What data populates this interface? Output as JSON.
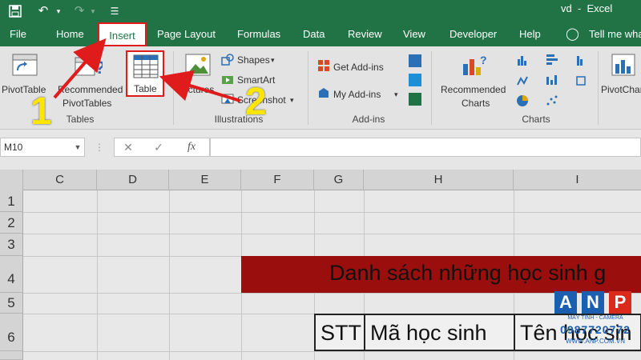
{
  "title_bar": {
    "title": "vd  -  Excel"
  },
  "tabs": [
    "File",
    "Home",
    "Insert",
    "Page Layout",
    "Formulas",
    "Data",
    "Review",
    "View",
    "Developer",
    "Help",
    "Tell me wha"
  ],
  "ribbon": {
    "pivot_table": "PivotTable",
    "recommended_pivot_1": "Recommended",
    "recommended_pivot_2": "PivotTables",
    "table": "Table",
    "pictures": "Pictures",
    "shapes": "Shapes",
    "smartart": "SmartArt",
    "screenshot": "Screenshot",
    "get_addins": "Get Add-ins",
    "my_addins": "My Add-ins",
    "rec_charts_1": "Recommended",
    "rec_charts_2": "Charts",
    "pivot_chart": "PivotChart",
    "groups": {
      "tables": "Tables",
      "illustrations": "Illustrations",
      "addins": "Add-ins",
      "charts": "Charts"
    }
  },
  "formula_bar": {
    "name_box": "M10",
    "cancel": "✕",
    "enter": "✓",
    "fx": "fx",
    "value": ""
  },
  "columns": [
    "C",
    "D",
    "E",
    "F",
    "G",
    "H",
    "I"
  ],
  "rows": [
    "1",
    "2",
    "3",
    "4",
    "5",
    "6"
  ],
  "sheet": {
    "title": "Danh sách những học sinh g",
    "headers": [
      "STT",
      "Mã học sinh",
      "Tên học sin"
    ]
  },
  "annotations": {
    "step1": "1",
    "step2": "2"
  },
  "watermark": {
    "letters": [
      "A",
      "N",
      "P"
    ],
    "line1": "MÁY TÍNH - CAMERA",
    "phone": "0987720772",
    "site": "WWW.ANP.COM.VN"
  },
  "colors": {
    "excel_green": "#217346",
    "highlight_red": "#e01b1b",
    "title_band": "#9a0e0e",
    "annotation_yellow": "#ffe600"
  }
}
